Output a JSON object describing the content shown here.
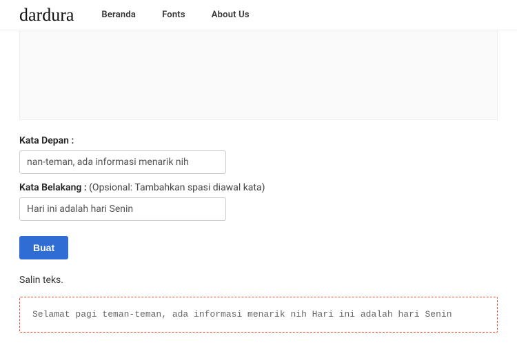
{
  "brand": "dardura",
  "nav": {
    "beranda": "Beranda",
    "fonts": "Fonts",
    "about": "About Us"
  },
  "form": {
    "front_label": "Kata Depan :",
    "front_value": "nan-teman, ada informasi menarik nih",
    "back_label": "Kata Belakang :",
    "back_optional": " (Opsional: Tambahkan spasi diawal kata)",
    "back_value": "Hari ini adalah hari Senin",
    "submit": "Buat"
  },
  "copy_label": "Salin teks.",
  "output": "Selamat pagi teman-teman, ada informasi menarik nih Hari ini adalah hari Senin"
}
